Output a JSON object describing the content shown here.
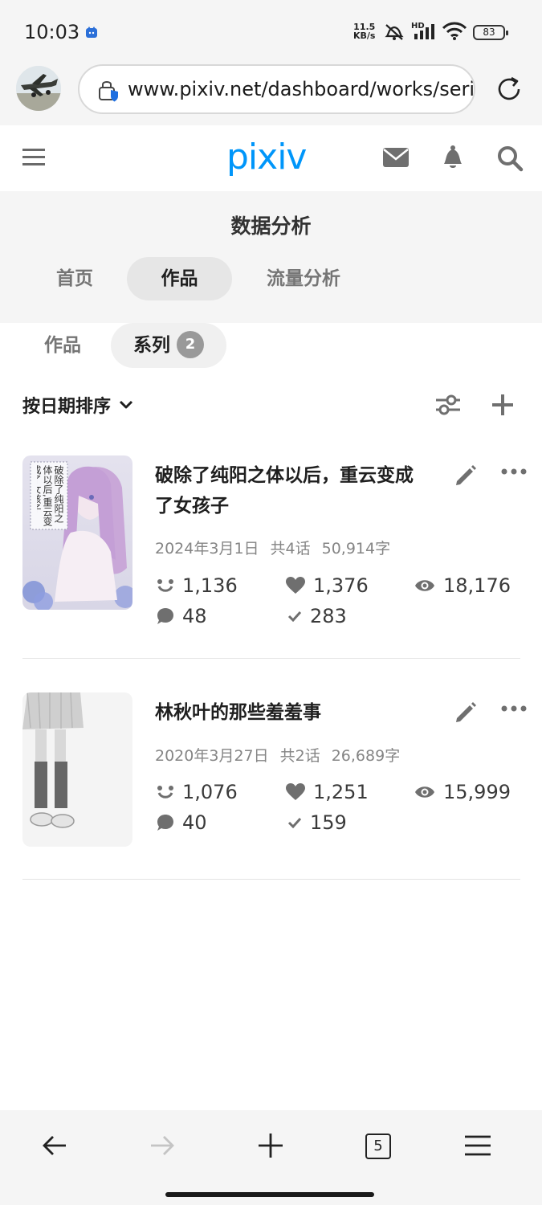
{
  "status_bar": {
    "time": "10:03",
    "net_speed_value": "11.5",
    "net_speed_unit": "KB/s",
    "network_label": "HD",
    "battery": "83"
  },
  "browser": {
    "url": "www.pixiv.net/dashboard/works/serie",
    "tab_count": "5"
  },
  "header": {
    "logo": "pixiv"
  },
  "analytics": {
    "title": "数据分析",
    "tabs": [
      {
        "label": "首页",
        "active": false
      },
      {
        "label": "作品",
        "active": true
      },
      {
        "label": "流量分析",
        "active": false
      }
    ]
  },
  "subtabs": {
    "works_label": "作品",
    "series_label": "系列",
    "series_count": "2"
  },
  "sort": {
    "label": "按日期排序"
  },
  "series": [
    {
      "title": "破除了纯阳之体以后，重云变成了女孩子",
      "thumbnail_text": "破除了纯阳之体以后,重云变成了女孩子",
      "date": "2024年3月1日",
      "episodes": "共4话",
      "chars": "50,914字",
      "reactions": "1,136",
      "likes": "1,376",
      "views": "18,176",
      "comments": "48",
      "bookmarks": "283"
    },
    {
      "title": "林秋叶的那些羞羞事",
      "date": "2020年3月27日",
      "episodes": "共2话",
      "chars": "26,689字",
      "reactions": "1,076",
      "likes": "1,251",
      "views": "15,999",
      "comments": "40",
      "bookmarks": "159"
    }
  ],
  "colors": {
    "brand": "#0096fa",
    "muted_text": "#858585",
    "icon_gray": "#6f6f6f",
    "tab_bg": "#e6e6e6",
    "badge": "#999999"
  }
}
